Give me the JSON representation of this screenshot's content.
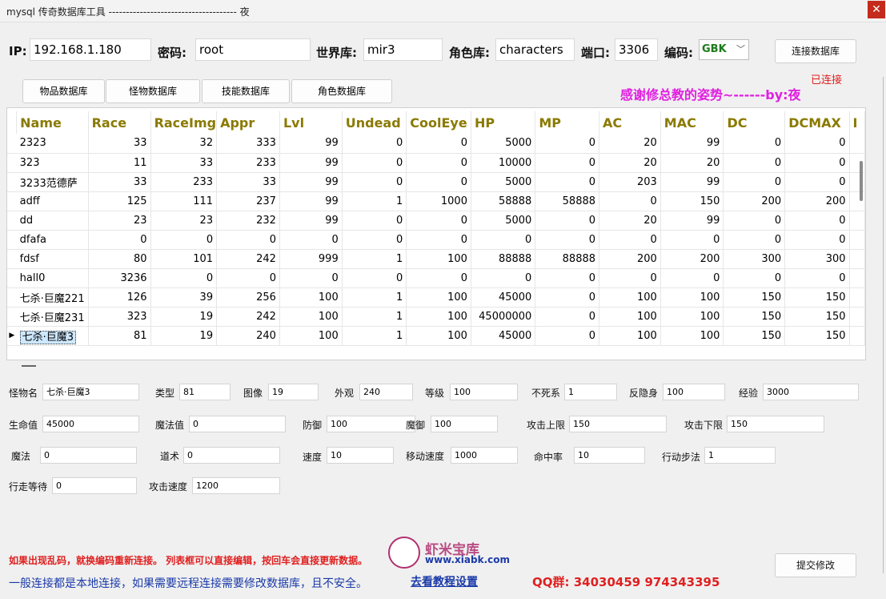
{
  "window": {
    "title": "mysql 传奇数据库工具 ------------------------------------- 夜",
    "close": "✕"
  },
  "conn": {
    "ip_label": "IP:",
    "ip": "192.168.1.180",
    "pwd_label": "密码:",
    "pwd": "root",
    "world_label": "世界库:",
    "world": "mir3",
    "role_label": "角色库:",
    "role": "characters",
    "port_label": "端口:",
    "port": "3306",
    "enc_label": "编码:",
    "enc": "GBK",
    "connect_btn": "连接数据库",
    "status": "已连接"
  },
  "tabs": [
    "物品数据库",
    "怪物数据库",
    "技能数据库",
    "角色数据库"
  ],
  "thanks": "感谢修总教的姿势~------by:夜",
  "grid": {
    "columns": [
      "Name",
      "Race",
      "RaceImg",
      "Appr",
      "Lvl",
      "Undead",
      "CoolEye",
      "HP",
      "MP",
      "AC",
      "MAC",
      "DC",
      "DCMAX",
      "I"
    ],
    "rows": [
      [
        "2323",
        "33",
        "32",
        "333",
        "99",
        "0",
        "0",
        "5000",
        "0",
        "20",
        "99",
        "0",
        "0"
      ],
      [
        "323",
        "11",
        "33",
        "233",
        "99",
        "0",
        "0",
        "10000",
        "0",
        "20",
        "20",
        "0",
        "0"
      ],
      [
        "3233范德萨",
        "33",
        "233",
        "33",
        "99",
        "0",
        "0",
        "5000",
        "0",
        "203",
        "99",
        "0",
        "0"
      ],
      [
        "adff",
        "125",
        "111",
        "237",
        "99",
        "1",
        "1000",
        "58888",
        "58888",
        "0",
        "150",
        "200",
        "200"
      ],
      [
        "dd",
        "23",
        "23",
        "232",
        "99",
        "0",
        "0",
        "5000",
        "0",
        "20",
        "99",
        "0",
        "0"
      ],
      [
        "dfafa",
        "0",
        "0",
        "0",
        "0",
        "0",
        "0",
        "0",
        "0",
        "0",
        "0",
        "0",
        "0"
      ],
      [
        "fdsf",
        "80",
        "101",
        "242",
        "999",
        "1",
        "100",
        "88888",
        "88888",
        "200",
        "200",
        "300",
        "300"
      ],
      [
        "hall0",
        "3236",
        "0",
        "0",
        "0",
        "0",
        "0",
        "0",
        "0",
        "0",
        "0",
        "0",
        "0"
      ],
      [
        "七杀·巨魔221",
        "126",
        "39",
        "256",
        "100",
        "1",
        "100",
        "45000",
        "0",
        "100",
        "100",
        "150",
        "150"
      ],
      [
        "七杀·巨魔231",
        "323",
        "19",
        "242",
        "100",
        "1",
        "100",
        "45000000",
        "0",
        "100",
        "100",
        "150",
        "150"
      ],
      [
        "七杀·巨魔3",
        "81",
        "19",
        "240",
        "100",
        "1",
        "100",
        "45000",
        "0",
        "100",
        "100",
        "150",
        "150"
      ]
    ],
    "selected_row": 10,
    "row_indicator": "▶"
  },
  "detail": {
    "name_l": "怪物名",
    "name": "七杀·巨魔3",
    "type_l": "类型",
    "type": "81",
    "img_l": "图像",
    "img": "19",
    "appr_l": "外观",
    "appr": "240",
    "lvl_l": "等级",
    "lvl": "100",
    "undead_l": "不死系",
    "undead": "1",
    "cooleye_l": "反隐身",
    "cooleye": "100",
    "exp_l": "经验",
    "exp": "3000",
    "hp_l": "生命值",
    "hp": "45000",
    "mp_l": "魔法值",
    "mp": "0",
    "ac_l": "防御",
    "ac": "100",
    "mac_l": "魔御",
    "mac": "100",
    "dcmax_l": "攻击上限",
    "dcmax": "150",
    "dc_l": "攻击下限",
    "dc": "150",
    "mc_l": "魔法",
    "mc": "0",
    "sc_l": "道术",
    "sc": "0",
    "speed_l": "速度",
    "speed": "10",
    "move_l": "移动速度",
    "move": "1000",
    "hit_l": "命中率",
    "hit": "10",
    "step_l": "行动步法",
    "step": "1",
    "wait_l": "行走等待",
    "wait": "0",
    "atkspd_l": "攻击速度",
    "atkspd": "1200"
  },
  "submit_btn": "提交修改",
  "hint1": "如果出现乱码，就换编码重新连接。 列表框可以直接编辑，按回车会直接更新数据。",
  "hint2": "一般连接都是本地连接，如果需要远程连接需要修改数据库，且不安全。",
  "tutorial_link": "去看教程设置",
  "qq": "QQ群:  34030459    974343395",
  "watermark": {
    "brand": "虾米宝库",
    "url": "www.xiabk.com"
  }
}
